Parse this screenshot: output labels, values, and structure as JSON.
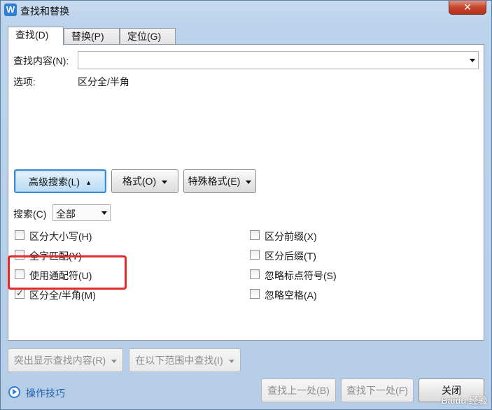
{
  "window": {
    "title": "查找和替换",
    "app_icon_letter": "W",
    "close_glyph": "✕"
  },
  "tabs": [
    {
      "label": "查找(D)",
      "active": true
    },
    {
      "label": "替换(P)",
      "active": false
    },
    {
      "label": "定位(G)",
      "active": false
    }
  ],
  "find": {
    "label": "查找内容(N):",
    "value": "",
    "options_label": "选项:",
    "options_value": "区分全/半角"
  },
  "buttons": {
    "advanced_search": "高级搜索(L)",
    "advanced_glyph": "▲",
    "format": "格式(O)",
    "special_format": "特殊格式(E)",
    "highlight": "突出显示查找内容(R)",
    "find_in": "在以下范围中查找(I)",
    "find_prev": "查找上一处(B)",
    "find_next": "查找下一处(F)",
    "close": "关闭"
  },
  "search": {
    "label": "搜索(C)",
    "value": "全部"
  },
  "options_left": [
    {
      "label": "区分大小写(H)",
      "checked": false
    },
    {
      "label": "全字匹配(Y)",
      "checked": false
    },
    {
      "label": "使用通配符(U)",
      "checked": false
    },
    {
      "label": "区分全/半角(M)",
      "checked": true
    }
  ],
  "options_right": [
    {
      "label": "区分前缀(X)",
      "checked": false
    },
    {
      "label": "区分后缀(T)",
      "checked": false
    },
    {
      "label": "忽略标点符号(S)",
      "checked": false
    },
    {
      "label": "忽略空格(A)",
      "checked": false
    }
  ],
  "footer": {
    "tips_link": "操作技巧"
  },
  "watermark": "Baidu 经验",
  "colors": {
    "accent": "#3a8ad4",
    "highlight_box": "#e4292b",
    "link": "#1f5fa8"
  }
}
